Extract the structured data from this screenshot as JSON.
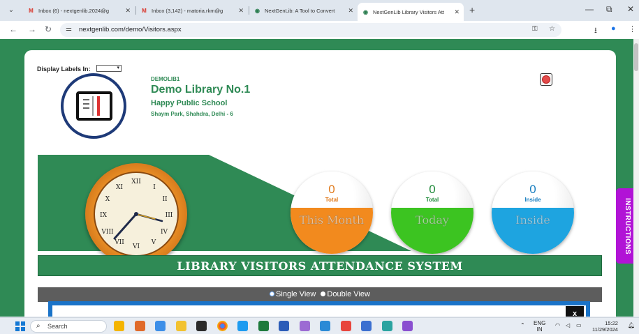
{
  "browser": {
    "tabs": [
      {
        "label": "Inbox (6) - nextgenlib.2024@g",
        "icon": "gmail-icon",
        "active": false
      },
      {
        "label": "Inbox (3,142) - matoria.rkm@g",
        "icon": "gmail-icon",
        "active": false
      },
      {
        "label": "NextGenLib: A Tool to Convert",
        "icon": "nextgenlib-icon",
        "active": false
      },
      {
        "label": "NextGenLib Library Visitors Att",
        "icon": "nextgenlib-icon",
        "active": true
      }
    ],
    "url": "nextgenlib.com/demo/Visitors.aspx"
  },
  "page": {
    "display_label": "Display Labels In:",
    "select_value": "",
    "library": {
      "code": "DEMOLIB1",
      "name": "Demo Library No.1",
      "school": "Happy Public School",
      "address": "Shaym Park, Shahdra, Delhi - 6"
    },
    "clock": {
      "numerals": [
        "XII",
        "I",
        "II",
        "III",
        "IV",
        "V",
        "VI",
        "VII",
        "VIII",
        "IX",
        "X",
        "XI"
      ]
    },
    "gauges": [
      {
        "value": "0",
        "caption": "Total",
        "watermark": "This Month",
        "color": "#f28a1e",
        "text_color": "#e0791a"
      },
      {
        "value": "0",
        "caption": "Total",
        "watermark": "Today",
        "color": "#3cc421",
        "text_color": "#1f8a3a"
      },
      {
        "value": "0",
        "caption": "Inside",
        "watermark": "Inside",
        "color": "#1ea4e0",
        "text_color": "#1a7fc0"
      }
    ],
    "title": "LIBRARY VISITORS ATTENDANCE SYSTEM",
    "view_options": {
      "single": "Single View",
      "double": "Double View",
      "selected": "double"
    },
    "modal_close": "x",
    "instructions": "INSTRUCTIONS"
  },
  "taskbar": {
    "search_placeholder": "Search",
    "lang_top": "ENG",
    "lang_bottom": "IN",
    "time": "15:22",
    "date": "11/29/2024"
  },
  "colors": {
    "brand_green": "#2f8a55",
    "accent_purple": "#b113d6",
    "modal_blue": "#1a73c8"
  }
}
